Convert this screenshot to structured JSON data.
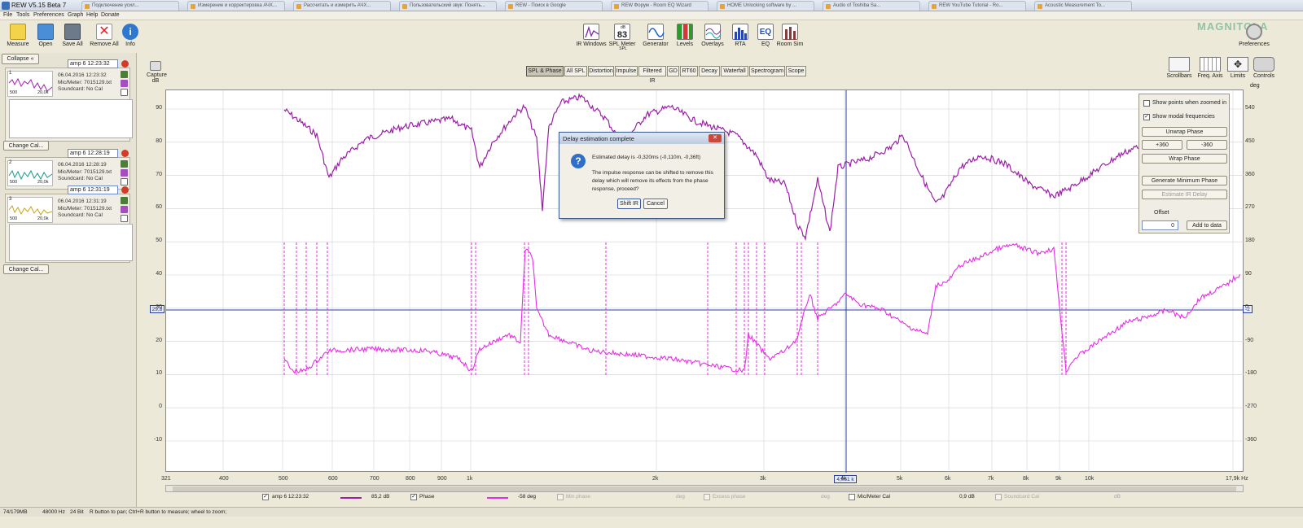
{
  "window": {
    "title": "REW V5.15 Beta 7"
  },
  "browser_tabs": [
    "Подключение усил...",
    "Измерение и корректировка АЧХ...",
    "Рассчитать и измерить АЧХ...",
    "Пользовательский звук: Понять...",
    "REW - Поиск в Google",
    "REW Форум - Room EQ Wizard",
    "HOME Unlocking software by ...",
    "Audio of Toshiba Sa...",
    "REW YouTube Tutorial - Ro...",
    "Acoustic Measurement To..."
  ],
  "menu": [
    "File",
    "Tools",
    "Preferences",
    "Graph",
    "Help",
    "Donate"
  ],
  "toolbar": {
    "measure": "Measure",
    "open": "Open",
    "save_all": "Save All",
    "remove_all": "Remove All",
    "info": "Info",
    "ir_windows": "IR Windows",
    "spl_meter": "SPL Meter",
    "spl_readout": "83",
    "spl_unit": "dB SPL",
    "generator": "Generator",
    "levels": "Levels",
    "overlays": "Overlays",
    "rta": "RTA",
    "eq": "EQ",
    "room_sim": "Room Sim",
    "preferences": "Preferences",
    "brand": "MAGNITOLA"
  },
  "left": {
    "collapse": "Collapse",
    "measurements": [
      {
        "number": "1",
        "name": "amp 6 12:23:32",
        "date": "06.04.2016 12:23:32",
        "mic": "Mic/Meter: 7015129.txt",
        "soundcard": "Soundcard: No Cal",
        "color": "#a020b0",
        "lo": "500",
        "hi": "20,0k"
      },
      {
        "number": "2",
        "name": "amp 6 12:28:19",
        "date": "06.04.2016 12:28:19",
        "mic": "Mic/Meter: 7015129.txt",
        "soundcard": "Soundcard: No Cal",
        "color": "#159a8c",
        "lo": "500",
        "hi": "20,0k"
      },
      {
        "number": "3",
        "name": "amp 6 12:31:19",
        "date": "06.04.2016 12:31:19",
        "mic": "Mic/Meter: 7015129.txt",
        "soundcard": "Soundcard: No Cal",
        "color": "#c8a21a",
        "lo": "500",
        "hi": "20,0k"
      }
    ],
    "change_cal": "Change Cal..."
  },
  "graph_tabs": [
    "SPL & Phase",
    "All SPL",
    "Distortion",
    "Impulse",
    "Filtered IR",
    "GD",
    "RT60",
    "Decay",
    "Waterfall",
    "Spectrogram",
    "Scope"
  ],
  "capture": {
    "label": "Capture",
    "unit": "dB"
  },
  "right_tools": {
    "scrollbars": "Scrollbars",
    "freq_axis": "Freq. Axis",
    "limits": "Limits",
    "controls": "Controls",
    "deg": "deg"
  },
  "controls": {
    "show_points": "Show points when zoomed in",
    "show_modal": "Show modal frequencies",
    "unwrap": "Unwrap Phase",
    "plus360": "+360",
    "minus360": "-360",
    "wrap": "Wrap Phase",
    "gen_min_phase": "Generate Minimum Phase",
    "estimate_ir_delay": "Estimate IR Delay",
    "offset": "Offset",
    "offset_value": "0",
    "add_to_data": "Add to data"
  },
  "axes": {
    "y_left": [
      "90",
      "80",
      "70",
      "60",
      "50",
      "40",
      "30",
      "20",
      "10",
      "0",
      "-10"
    ],
    "y_right": [
      "540",
      "450",
      "360",
      "270",
      "180",
      "90",
      "0",
      "-90",
      "-180",
      "-270",
      "-360"
    ],
    "x": [
      "321",
      "400",
      "500",
      "600",
      "700",
      "800",
      "900",
      "1k",
      "2k",
      "3k",
      "4k",
      "5k",
      "6k",
      "7k",
      "8k",
      "9k",
      "10k",
      "17,9k Hz"
    ],
    "cursor_y": "29,8",
    "cursor_x": "4,061 k",
    "cursor_right": "-2"
  },
  "dialog": {
    "title": "Delay estimation complete",
    "line1": "Estimated delay is -0,320ms (-0,110m, -0,36ft)",
    "line2": "The impulse response can be shifted to remove this",
    "line3": "delay which will remove its effects from the phase",
    "line4": "response, proceed?",
    "shift": "Shift IR",
    "cancel": "Cancel"
  },
  "legend": {
    "name": "amp 6 12:23:32",
    "spl_value": "85,2 dB",
    "phase": "Phase",
    "phase_value": "-58 deg",
    "min_phase": "Min phase",
    "deg1": "deg",
    "excess_phase": "Excess phase",
    "deg2": "deg",
    "mic_cal": "Mic/Meter Cal",
    "mic_value": "0,9 dB",
    "soundcard_cal": "Soundcard Cal",
    "db": "dB"
  },
  "status": {
    "mem": "74/179MB",
    "rate": "48000 Hz",
    "bits": "24 Bit",
    "hint": "R button to pan; Ctrl+R button to measure; wheel to zoom;"
  },
  "colors": {
    "spl": "#9b1fa8",
    "phase": "#e62ee6",
    "cursor": "#2a3ea0"
  }
}
